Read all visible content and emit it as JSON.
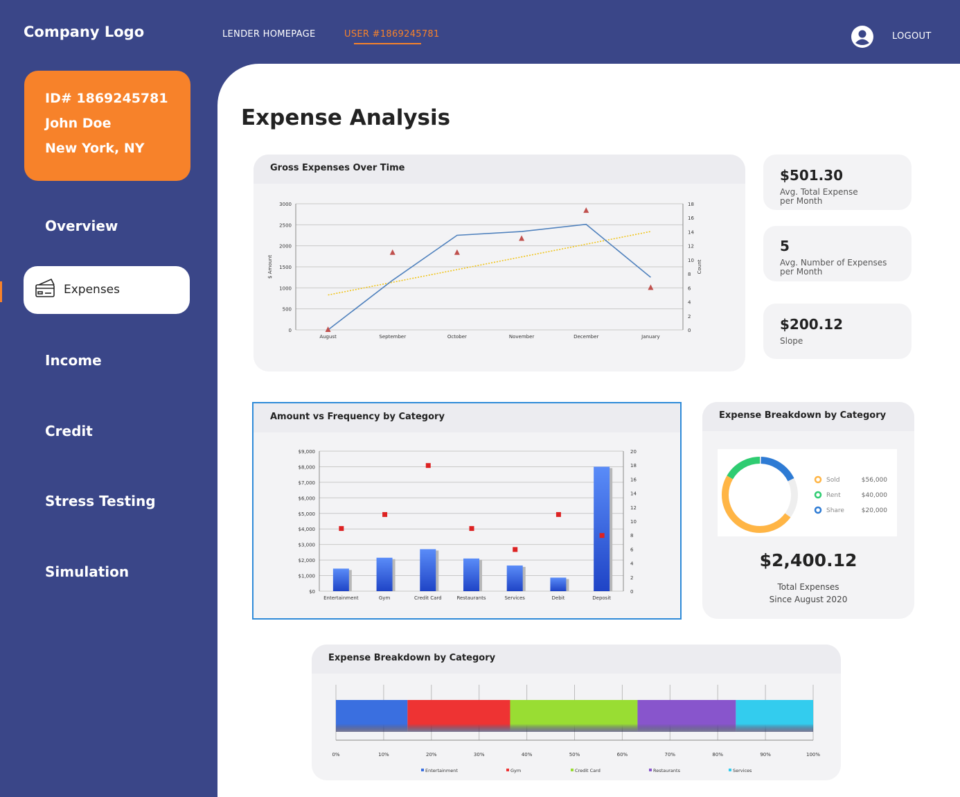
{
  "header": {
    "logo": "Company Logo",
    "nav": [
      {
        "label": "LENDER HOMEPAGE"
      },
      {
        "label": "USER #1869245781"
      }
    ],
    "logout": "LOGOUT"
  },
  "profile": {
    "id": "ID# 1869245781",
    "name": "John Doe",
    "location": "New York, NY"
  },
  "sidebar": {
    "items": [
      {
        "label": "Overview"
      },
      {
        "label": "Expenses"
      },
      {
        "label": "Income"
      },
      {
        "label": "Credit"
      },
      {
        "label": "Stress Testing"
      },
      {
        "label": "Simulation"
      }
    ]
  },
  "page": {
    "title": "Expense Analysis"
  },
  "stats": [
    {
      "value": "$501.30",
      "label": "Avg. Total Expense per Month"
    },
    {
      "value": "5",
      "label": "Avg. Number of Expenses per Month"
    },
    {
      "value": "$200.12",
      "label": "Slope"
    }
  ],
  "colors": {
    "sidebar": "#3a4688",
    "accent": "#f7822a",
    "selection": "#2e8ad8"
  },
  "chart_data": [
    {
      "type": "line",
      "title": "Gross Expenses Over Time",
      "ylabel": "$ Amount",
      "y2label": "Count",
      "categories": [
        "August",
        "September",
        "October",
        "November",
        "December",
        "January"
      ],
      "ylim": [
        0,
        3000
      ],
      "y2lim": [
        0,
        18
      ],
      "yticks": [
        "0",
        "500",
        "1000",
        "1500",
        "2000",
        "2500",
        "3000"
      ],
      "y2ticks": [
        "0",
        "2",
        "4",
        "6",
        "8",
        "10",
        "12",
        "14",
        "16",
        "18"
      ],
      "series": [
        {
          "values": [
            0,
            1180,
            2250,
            2340,
            2510,
            1250
          ],
          "color": "#4f81bd"
        },
        {
          "values": [
            0,
            11,
            11,
            13,
            17,
            6
          ],
          "axis": "right",
          "marker": "triangle",
          "color": "#c0504d"
        }
      ],
      "trendline": {
        "start": 830,
        "end": 2340,
        "color": "#f0c419"
      }
    },
    {
      "type": "bar",
      "title": "Amount vs Frequency by Category",
      "categories": [
        "Entertainment",
        "Gym",
        "Credit Card",
        "Restaurants",
        "Services",
        "Debit",
        "Deposit"
      ],
      "ylim": [
        0,
        9000
      ],
      "y2lim": [
        0,
        20
      ],
      "yticks": [
        "$0",
        "$1,000",
        "$2,000",
        "$3,000",
        "$4,000",
        "$5,000",
        "$6,000",
        "$7,000",
        "$8,000",
        "$9,000"
      ],
      "y2ticks": [
        "0",
        "2",
        "4",
        "6",
        "8",
        "10",
        "12",
        "14",
        "16",
        "18",
        "20"
      ],
      "series": [
        {
          "values": [
            1450,
            2150,
            2700,
            2100,
            1650,
            870,
            8000
          ],
          "color": "#3a6fe0"
        },
        {
          "values": [
            9,
            11,
            18,
            9,
            6,
            11,
            8
          ],
          "axis": "right",
          "marker": "square",
          "color": "#dd2222"
        }
      ]
    },
    {
      "type": "pie",
      "title": "Expense Breakdown by Category",
      "labels": [
        "Sold",
        "Rent",
        "Share"
      ],
      "display_values": [
        "$56,000",
        "$40,000",
        "$20,000"
      ],
      "values": [
        56000,
        40000,
        20000
      ],
      "colors": [
        "#ffb545",
        "#2ecc71",
        "#2e7bd4"
      ],
      "total": "$2,400.12",
      "total_label": "Total Expenses",
      "total_sub": "Since August 2020"
    },
    {
      "type": "bar",
      "orientation": "horizontal-stacked",
      "title": "Expense Breakdown by Category",
      "xticks": [
        "0%",
        "10%",
        "20%",
        "30%",
        "40%",
        "50%",
        "60%",
        "70%",
        "80%",
        "90%",
        "100%"
      ],
      "series": [
        {
          "name": "Entertainment",
          "value": 15,
          "color": "#3a6fe0"
        },
        {
          "name": "Gym",
          "value": 21.5,
          "color": "#ee3333"
        },
        {
          "name": "Credit Card",
          "value": 26.7,
          "color": "#99dd33"
        },
        {
          "name": "Restaurants",
          "value": 20.6,
          "color": "#8855cc"
        },
        {
          "name": "Services",
          "value": 16.2,
          "color": "#33ccee"
        }
      ]
    }
  ]
}
